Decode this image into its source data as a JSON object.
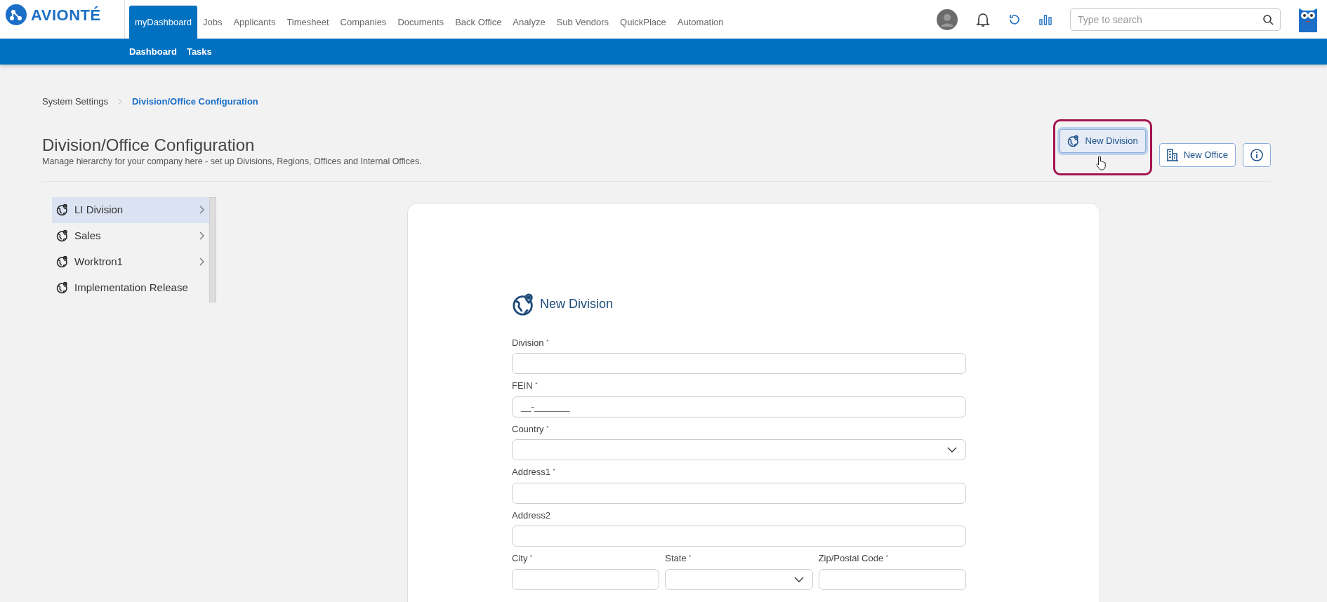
{
  "brand": {
    "name": "AVIONTÉ"
  },
  "nav": [
    {
      "label": "myDashboard",
      "selected": true
    },
    {
      "label": "Jobs",
      "selected": false
    },
    {
      "label": "Applicants",
      "selected": false
    },
    {
      "label": "Timesheet",
      "selected": false
    },
    {
      "label": "Companies",
      "selected": false
    },
    {
      "label": "Documents",
      "selected": false
    },
    {
      "label": "Back Office",
      "selected": false
    },
    {
      "label": "Analyze",
      "selected": false
    },
    {
      "label": "Sub Vendors",
      "selected": false
    },
    {
      "label": "QuickPlace",
      "selected": false
    },
    {
      "label": "Automation",
      "selected": false
    }
  ],
  "search": {
    "placeholder": "Type to search"
  },
  "subnav": [
    "Dashboard",
    "Tasks"
  ],
  "breadcrumb": [
    {
      "label": "System Settings",
      "selected": false
    },
    {
      "label": "Division/Office Configuration",
      "selected": true
    }
  ],
  "page": {
    "title": "Division/Office Configuration",
    "subtitle": "Manage hierarchy for your company here - set up Divisions, Regions, Offices and Internal Offices."
  },
  "actions": [
    {
      "kind": "division",
      "label": "New Division",
      "focused": true,
      "highlighted": true
    },
    {
      "kind": "office",
      "label": "New Office",
      "focused": false,
      "highlighted": false
    },
    {
      "kind": "info",
      "focused": false,
      "highlighted": false
    }
  ],
  "divisions": [
    {
      "label": "LI Division",
      "selected": true,
      "expandable": true
    },
    {
      "label": "Sales",
      "selected": false,
      "expandable": true
    },
    {
      "label": "Worktron1",
      "selected": false,
      "expandable": true
    },
    {
      "label": "Implementation Release",
      "selected": false,
      "expandable": false
    }
  ],
  "form": {
    "title": "New Division",
    "rows": [
      [
        {
          "kind": "text",
          "label": "Division $^{*}$"
        }
      ],
      [
        {
          "kind": "text",
          "label": "FEIN $^{*}$",
          "value": "__-_______"
        }
      ],
      [
        {
          "kind": "select",
          "label": "Country $^{*}$"
        }
      ],
      [
        {
          "kind": "text",
          "label": "Address1 $^{*}$"
        }
      ],
      [
        {
          "kind": "text",
          "label": "Address2"
        }
      ],
      [
        {
          "kind": "text",
          "label": "City $^{*}$"
        },
        {
          "kind": "select",
          "label": "State $^{*}$"
        },
        {
          "kind": "text",
          "label": "Zip/Postal Code $^{*}$"
        }
      ]
    ]
  }
}
